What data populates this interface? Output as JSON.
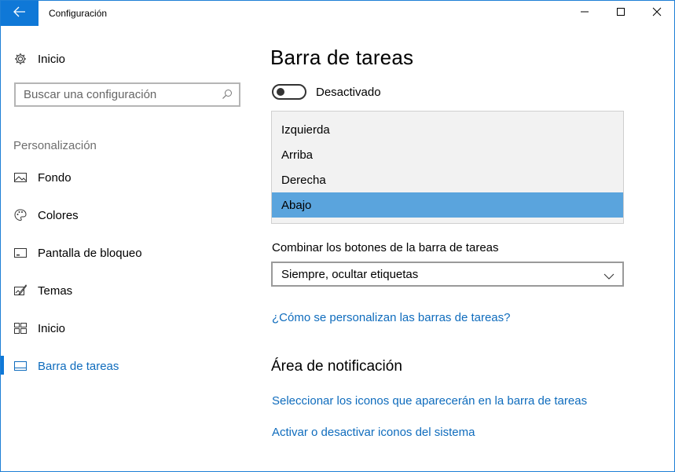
{
  "window": {
    "title": "Configuración",
    "accent_color": "#0f78d7"
  },
  "icons": {
    "back": "arrow-left-icon",
    "minimize": "minimize-icon",
    "maximize": "maximize-icon",
    "close": "close-icon",
    "home": "gear-icon",
    "search": "search-icon",
    "chevron": "chevron-down-icon"
  },
  "sidebar": {
    "home_label": "Inicio",
    "search_placeholder": "Buscar una configuración",
    "section_label": "Personalización",
    "items": [
      {
        "label": "Fondo",
        "icon": "picture-icon"
      },
      {
        "label": "Colores",
        "icon": "palette-icon"
      },
      {
        "label": "Pantalla de bloqueo",
        "icon": "lock-screen-icon"
      },
      {
        "label": "Temas",
        "icon": "themes-icon"
      },
      {
        "label": "Inicio",
        "icon": "start-grid-icon"
      },
      {
        "label": "Barra de tareas",
        "icon": "taskbar-icon",
        "active": true
      }
    ]
  },
  "main": {
    "title": "Barra de tareas",
    "toggle_label": "Desactivado",
    "toggle_state": "off",
    "position_options": [
      "Izquierda",
      "Arriba",
      "Derecha",
      "Abajo"
    ],
    "position_selected": "Abajo",
    "selection_color": "#5aa4dd",
    "combine_label": "Combinar los botones de la barra de tareas",
    "combine_value": "Siempre, ocultar etiquetas",
    "help_link": "¿Cómo se personalizan las barras de tareas?",
    "notification_title": "Área de notificación",
    "notification_links": [
      "Seleccionar los iconos que aparecerán en la barra de tareas",
      "Activar o desactivar iconos del sistema"
    ],
    "link_color": "#0f6cbd"
  }
}
